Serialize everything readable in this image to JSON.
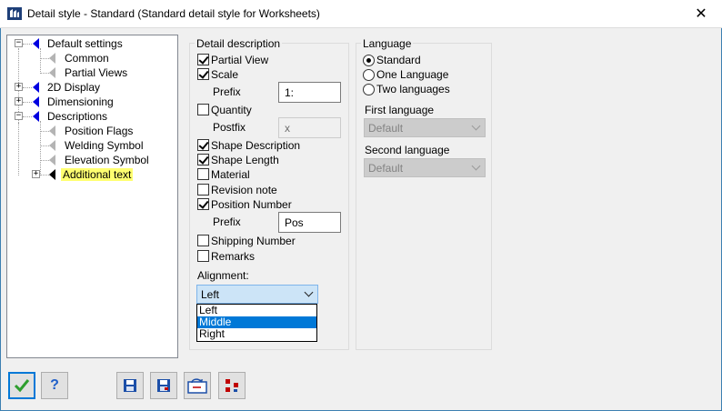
{
  "window": {
    "title": "Detail style - Standard (Standard detail style for Worksheets)",
    "close_glyph": "✕",
    "app_icon": "app-icon"
  },
  "tree": {
    "items": [
      {
        "label": "Default settings",
        "icon": "blue-flag-icon",
        "expander": "−"
      },
      {
        "label": "Common",
        "icon": "gray-flag-icon"
      },
      {
        "label": "Partial Views",
        "icon": "gray-flag-icon"
      },
      {
        "label": "2D Display",
        "icon": "blue-flag-icon",
        "expander": "+"
      },
      {
        "label": "Dimensioning",
        "icon": "blue-flag-icon",
        "expander": "+"
      },
      {
        "label": "Descriptions",
        "icon": "blue-flag-icon",
        "expander": "−"
      },
      {
        "label": "Position Flags",
        "icon": "gray-flag-icon"
      },
      {
        "label": "Welding Symbol",
        "icon": "gray-flag-icon"
      },
      {
        "label": "Elevation Symbol",
        "icon": "gray-flag-icon"
      },
      {
        "label": "Additional text",
        "icon": "black-flag-icon",
        "expander": "+",
        "selected": true
      }
    ]
  },
  "detail_description": {
    "title": "Detail description",
    "partial_view": {
      "label": "Partial View",
      "checked": true
    },
    "scale": {
      "label": "Scale",
      "checked": true
    },
    "scale_prefix": {
      "label": "Prefix",
      "value": "1:"
    },
    "quantity": {
      "label": "Quantity",
      "checked": false
    },
    "quantity_postfix": {
      "label": "Postfix",
      "value": "x"
    },
    "shape_description": {
      "label": "Shape Description",
      "checked": true
    },
    "shape_length": {
      "label": "Shape Length",
      "checked": true
    },
    "material": {
      "label": "Material",
      "checked": false
    },
    "revision_note": {
      "label": "Revision note",
      "checked": false
    },
    "position_number": {
      "label": "Position Number",
      "checked": true
    },
    "position_prefix": {
      "label": "Prefix",
      "value": "Pos"
    },
    "shipping_number": {
      "label": "Shipping Number",
      "checked": false
    },
    "remarks": {
      "label": "Remarks",
      "checked": false
    },
    "alignment": {
      "label": "Alignment:",
      "selected": "Left",
      "options": [
        "Left",
        "Middle",
        "Right"
      ],
      "highlighted": "Middle"
    }
  },
  "language": {
    "title": "Language",
    "options": [
      {
        "label": "Standard",
        "checked": true
      },
      {
        "label": "One Language",
        "checked": false
      },
      {
        "label": "Two languages",
        "checked": false
      }
    ],
    "first_language": {
      "label": "First language",
      "value": "Default"
    },
    "second_language": {
      "label": "Second language",
      "value": "Default"
    }
  },
  "buttons": {
    "ok_icon": "checkmark-icon",
    "help_label": "?",
    "save_icon": "save-icon",
    "save_as_icon": "save-as-icon",
    "load_icon": "load-icon",
    "organize_icon": "organize-icon"
  },
  "colors": {
    "tree_selected": "#ffff70",
    "blue_flag": "#0000e0",
    "highlight": "#0078d7",
    "ok_check": "#2e9e2e",
    "help_q": "#1f5fc9"
  }
}
